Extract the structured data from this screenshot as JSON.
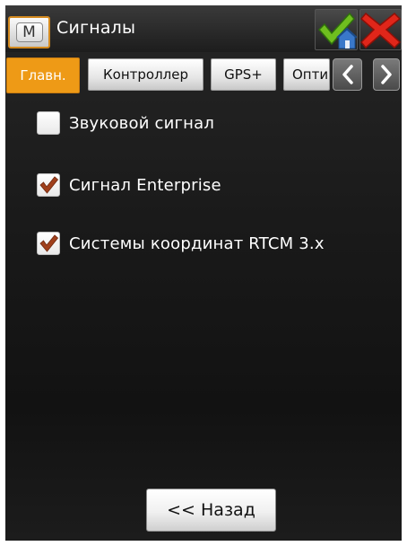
{
  "window": {
    "menu_icon": "M",
    "title": "Сигналы",
    "ok_icon": "checkmark-home-icon",
    "close_icon": "red-x-icon"
  },
  "tabs": [
    {
      "label": "Главн.",
      "active": true
    },
    {
      "label": "Контроллер",
      "active": false
    },
    {
      "label": "GPS+",
      "active": false
    },
    {
      "label": "Опти",
      "active": false
    }
  ],
  "tab_nav": {
    "prev_icon": "chevron-left-icon",
    "next_icon": "chevron-right-icon"
  },
  "options": [
    {
      "label": "Звуковой сигнал",
      "checked": false
    },
    {
      "label": "Сигнал Enterprise",
      "checked": true
    },
    {
      "label": "Системы координат RTCM 3.x",
      "checked": true
    }
  ],
  "footer": {
    "back_label": "<< Назад"
  },
  "colors": {
    "accent": "#EE9A16",
    "checkmark": "#A0401C",
    "background": "#1A1A1A"
  }
}
